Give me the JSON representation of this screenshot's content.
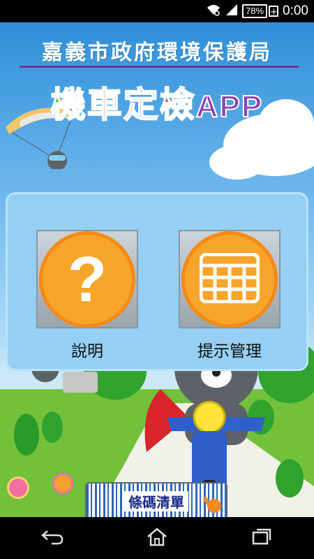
{
  "status_bar": {
    "battery_level": "78%",
    "time": "0:00",
    "icons": [
      "wifi-icon",
      "signal-icon",
      "battery-icon"
    ]
  },
  "header": {
    "agency": "嘉義市政府環境保護局",
    "app_title_chars": [
      "機",
      "車",
      "定",
      "檢",
      "APP"
    ]
  },
  "menu": {
    "items": [
      {
        "label": "說明",
        "icon": "question-icon"
      },
      {
        "label": "提示管理",
        "icon": "calendar-grid-icon"
      }
    ]
  },
  "barcode_button": {
    "label": "條碼清單"
  },
  "nav_bar": {
    "icons": [
      "back-icon",
      "home-icon",
      "recents-icon"
    ]
  },
  "colors": {
    "accent_orange": "#f7a42a",
    "panel_blue": "#95cff3",
    "title_green": "#49a92a",
    "title_red": "#e8221b",
    "title_blue": "#2a57c7",
    "title_purple": "#8d3fb4"
  }
}
